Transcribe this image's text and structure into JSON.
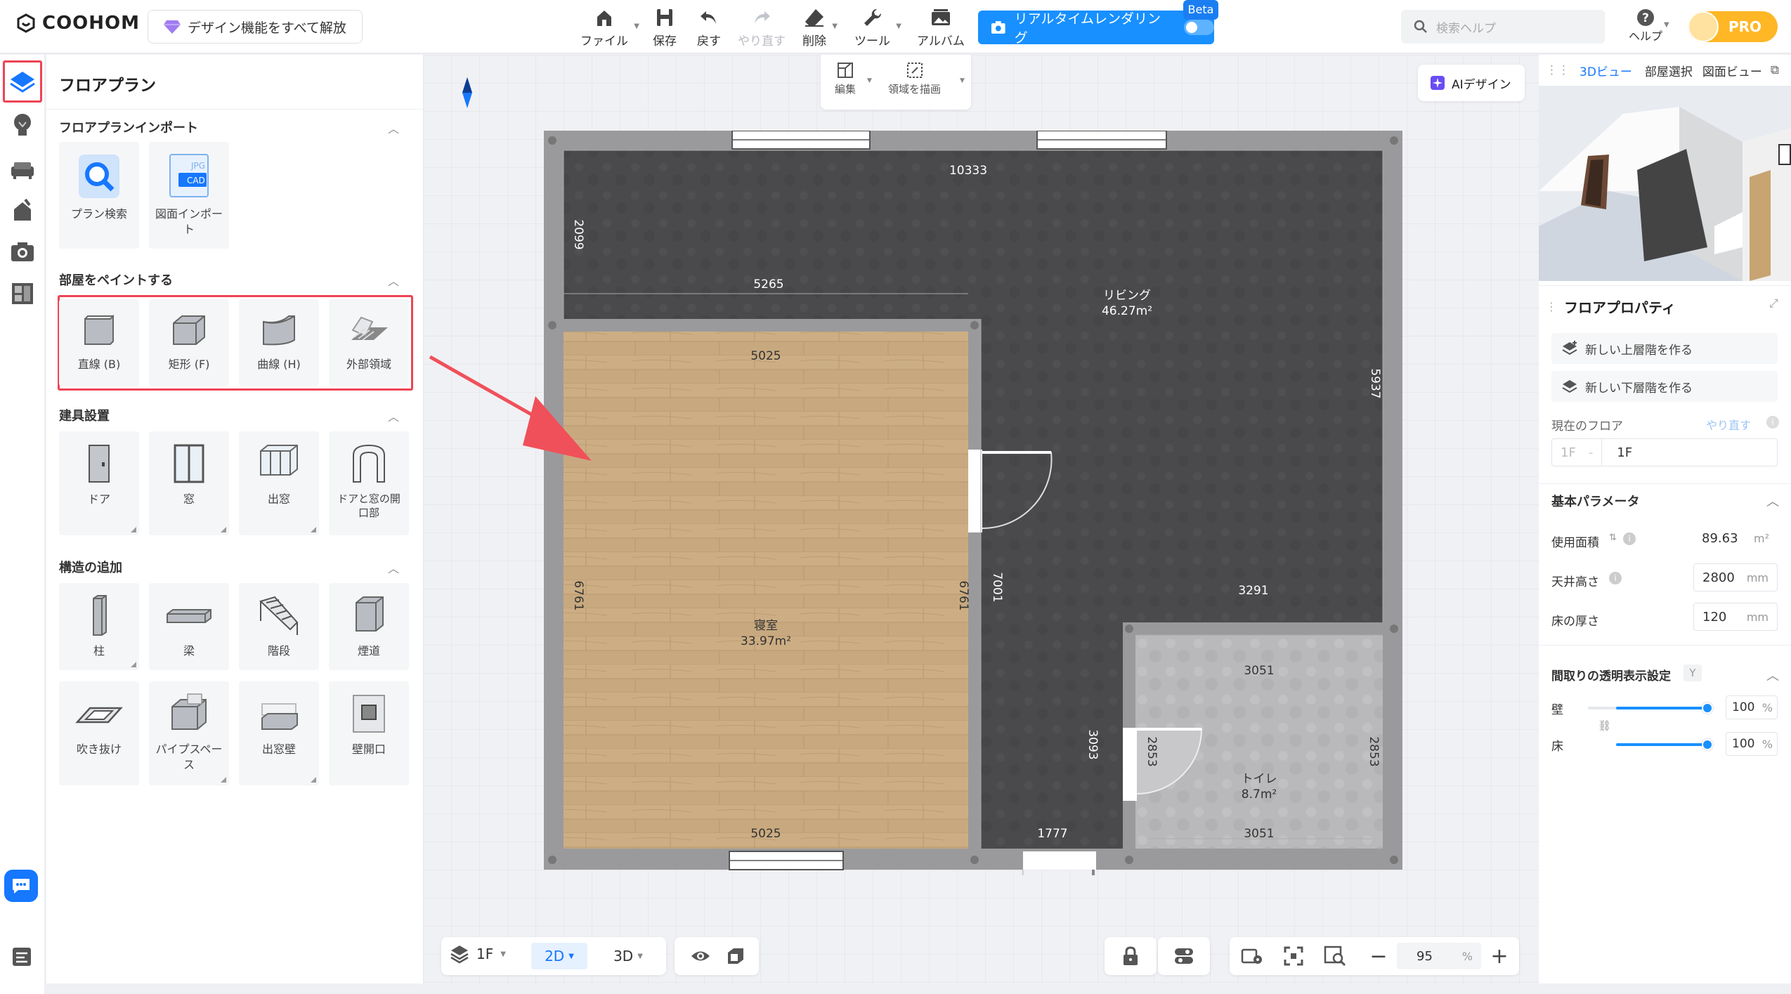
{
  "app": {
    "brand": "COOHOM",
    "unlock_label": "デザイン機能をすべて解放"
  },
  "toolbar": {
    "file": "ファイル",
    "save": "保存",
    "undo": "戻す",
    "redo": "やり直す",
    "delete": "削除",
    "tools": "ツール",
    "album": "アルバム",
    "realtime": "リアルタイムレンダリング",
    "beta": "Beta",
    "search_placeholder": "検索ヘルプ",
    "help": "ヘルプ",
    "pro": "PRO"
  },
  "left_panel": {
    "title": "フロアプラン",
    "sections": [
      {
        "title": "フロアプランインポート",
        "items": [
          "プラン検索",
          "図面インポート"
        ]
      },
      {
        "title": "部屋をペイントする",
        "items": [
          "直線 (B)",
          "矩形 (F)",
          "曲線 (H)",
          "外部領域"
        ]
      },
      {
        "title": "建具設置",
        "items": [
          "ドア",
          "窓",
          "出窓",
          "ドアと窓の開口部"
        ]
      },
      {
        "title": "構造の追加",
        "items": [
          "柱",
          "梁",
          "階段",
          "煙道",
          "吹き抜け",
          "パイプスペース",
          "出窓壁",
          "壁開口"
        ]
      }
    ]
  },
  "canvas_toolbar": {
    "edit": "編集",
    "draw_region": "領域を描画",
    "ai_design": "AIデザイン"
  },
  "floorplan": {
    "rooms": [
      {
        "name": "リビング",
        "area": "46.27m²"
      },
      {
        "name": "寝室",
        "area": "33.97m²"
      },
      {
        "name": "トイレ",
        "area": "8.7m²"
      }
    ],
    "dimensions": {
      "top": "10333",
      "living_left": "2099",
      "living_mid": "5265",
      "living_right": "5937",
      "bed_top": "5025",
      "bed_bottom": "5025",
      "bed_left": "6761",
      "bed_right": "6761",
      "corridor": "7001",
      "toilet_top_outer": "3291",
      "toilet_top": "3051",
      "toilet_bottom": "3051",
      "toilet_left": "2853",
      "toilet_right": "2853",
      "toilet_door_side": "3093",
      "corridor_bottom": "1777"
    }
  },
  "bottom_bar": {
    "floor": "1F",
    "mode_2d": "2D",
    "mode_3d": "3D",
    "zoom": "95",
    "zoom_unit": "%"
  },
  "right_panel": {
    "tabs": [
      "3Dビュー",
      "部屋選択",
      "図面ビュー"
    ],
    "floor_props_title": "フロアプロパティ",
    "new_upper": "新しい上層階を作る",
    "new_lower": "新しい下層階を作る",
    "current_floor_label": "現在のフロア",
    "redo_link": "やり直す",
    "floor_prefix": "1F",
    "floor_value": "1F",
    "basic_params_title": "基本パラメータ",
    "usable_area_label": "使用面積",
    "usable_area_value": "89.63",
    "usable_area_unit": "m²",
    "ceiling_label": "天井高さ",
    "ceiling_value": "2800",
    "ceiling_unit": "mm",
    "floor_thickness_label": "床の厚さ",
    "floor_thickness_value": "120",
    "floor_thickness_unit": "mm",
    "transparency_title": "間取りの透明表示設定",
    "transparency_badge": "Y",
    "wall_label": "壁",
    "wall_value": "100",
    "wall_unit": "%",
    "floor_label": "床",
    "floor_value_pct": "100",
    "floor_unit": "%"
  }
}
